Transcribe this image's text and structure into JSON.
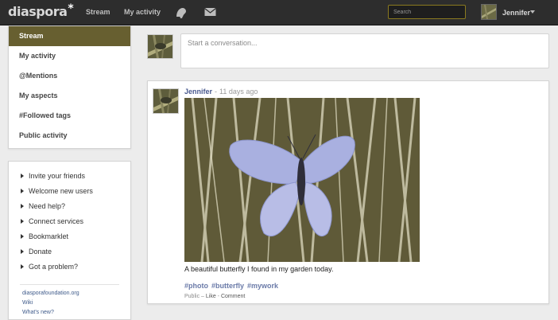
{
  "header": {
    "logo_text": "diaspora",
    "logo_star": "*",
    "nav": {
      "stream_label": "Stream",
      "activity_label": "My activity"
    },
    "icons": [
      "notifications-icon",
      "messages-icon"
    ],
    "search": {
      "placeholder": "Search",
      "value": ""
    },
    "user": {
      "name": "Jennifer"
    }
  },
  "sidebar": {
    "nav_items": [
      {
        "label": "Stream",
        "active": true
      },
      {
        "label": "My activity"
      },
      {
        "label": "@Mentions"
      },
      {
        "label": "My aspects"
      },
      {
        "label": "#Followed tags"
      },
      {
        "label": "Public activity"
      }
    ],
    "links": [
      {
        "label": "Invite your friends"
      },
      {
        "label": "Welcome new users"
      },
      {
        "label": "Need help?"
      },
      {
        "label": "Connect services"
      },
      {
        "label": "Bookmarklet"
      },
      {
        "label": "Donate"
      },
      {
        "label": "Got a problem?"
      }
    ],
    "footer_links": [
      {
        "label": "diasporafoundation.org"
      },
      {
        "label": "Wiki"
      },
      {
        "label": "What's new?"
      }
    ]
  },
  "publisher": {
    "placeholder": "Start a conversation..."
  },
  "post": {
    "author": "Jennifer",
    "separator": "-",
    "time": "11 days ago",
    "text": "A beautiful butterfly I found in my garden today.",
    "tags": [
      "#photo",
      "#butterfly",
      "#mywork"
    ],
    "actions": {
      "visibility": "Public",
      "dot1": " – ",
      "like": "Like",
      "dot2": " - ",
      "comment": "Comment"
    }
  },
  "colors": {
    "header_bg": "#2d2d2d",
    "active_nav_bg": "#675f30",
    "link_blue": "#4a5a8f",
    "search_border": "#8a7a1f"
  }
}
